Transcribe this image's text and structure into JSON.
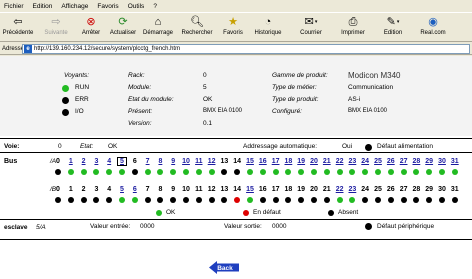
{
  "menu": {
    "items": [
      "Fichier",
      "Edition",
      "Affichage",
      "Favoris",
      "Outils",
      "?"
    ]
  },
  "toolbar": {
    "buttons": [
      {
        "label": "Précédente",
        "icon": "back-arrow-icon",
        "enabled": true
      },
      {
        "label": "Suivante",
        "icon": "forward-arrow-icon",
        "enabled": false
      },
      {
        "label": "Arrêter",
        "icon": "stop-icon",
        "enabled": true
      },
      {
        "label": "Actualiser",
        "icon": "refresh-icon",
        "enabled": true
      },
      {
        "label": "Démarrage",
        "icon": "home-icon",
        "enabled": true
      },
      {
        "label": "Rechercher",
        "icon": "search-icon",
        "enabled": true
      },
      {
        "label": "Favoris",
        "icon": "favorites-icon",
        "enabled": true
      },
      {
        "label": "Historique",
        "icon": "history-icon",
        "enabled": true
      },
      {
        "label": "Courrier",
        "icon": "mail-icon",
        "enabled": true
      },
      {
        "label": "Imprimer",
        "icon": "print-icon",
        "enabled": true
      },
      {
        "label": "Edition",
        "icon": "edit-icon",
        "enabled": true
      },
      {
        "label": "Real.com",
        "icon": "real-icon",
        "enabled": true
      }
    ]
  },
  "address": {
    "label": "Adresse",
    "url": "http://139.160.234.12/secure/system/plcctg_french.htm"
  },
  "info": {
    "voyants_label": "Voyants:",
    "leds": [
      {
        "label": "RUN",
        "color": "#22bb22"
      },
      {
        "label": "ERR",
        "color": "#000000"
      },
      {
        "label": "I/O",
        "color": "#000000"
      }
    ],
    "rack_label": "Rack:",
    "rack_value": "0",
    "module_label": "Module:",
    "module_value": "5",
    "etat_label": "Etat du module:",
    "etat_value": "OK",
    "present_label": "Présent:",
    "present_value": "BMX EIA 0100",
    "version_label": "Version:",
    "version_value": "0.1",
    "gamme_label": "Gamme de produit:",
    "gamme_value": "Modicon M340",
    "metier_label": "Type de métier:",
    "metier_value": "Communication",
    "type_label": "Type de produit:",
    "type_value": "AS-i",
    "configure_label": "Configuré:",
    "configure_value": "BMX EIA 0100"
  },
  "voie": {
    "label": "Voie:",
    "value": "0",
    "etat_label": "Etat:",
    "etat_value": "OK",
    "addr_label": "Addressage automatique:",
    "addr_value": "Oui",
    "alim_label": "Défaut alimentation",
    "alim_color": "#000000"
  },
  "bus": {
    "label": "Bus",
    "rowA_label": "/A",
    "rowB_label": "/B",
    "rowA": [
      {
        "n": "0",
        "link": false,
        "color": "#000000"
      },
      {
        "n": "1",
        "link": true,
        "color": "#22bb22"
      },
      {
        "n": "2",
        "link": true,
        "color": "#22bb22"
      },
      {
        "n": "3",
        "link": true,
        "color": "#22bb22"
      },
      {
        "n": "4",
        "link": true,
        "color": "#22bb22"
      },
      {
        "n": "5",
        "link": true,
        "color": "#22bb22",
        "selected": true
      },
      {
        "n": "6",
        "link": false,
        "color": "#000000"
      },
      {
        "n": "7",
        "link": true,
        "color": "#22bb22"
      },
      {
        "n": "8",
        "link": true,
        "color": "#22bb22"
      },
      {
        "n": "9",
        "link": true,
        "color": "#22bb22"
      },
      {
        "n": "10",
        "link": true,
        "color": "#22bb22"
      },
      {
        "n": "11",
        "link": true,
        "color": "#22bb22"
      },
      {
        "n": "12",
        "link": true,
        "color": "#22bb22"
      },
      {
        "n": "13",
        "link": false,
        "color": "#000000"
      },
      {
        "n": "14",
        "link": false,
        "color": "#000000"
      },
      {
        "n": "15",
        "link": true,
        "color": "#22bb22"
      },
      {
        "n": "16",
        "link": true,
        "color": "#22bb22"
      },
      {
        "n": "17",
        "link": true,
        "color": "#22bb22"
      },
      {
        "n": "18",
        "link": true,
        "color": "#22bb22"
      },
      {
        "n": "19",
        "link": true,
        "color": "#22bb22"
      },
      {
        "n": "20",
        "link": true,
        "color": "#22bb22"
      },
      {
        "n": "21",
        "link": true,
        "color": "#22bb22"
      },
      {
        "n": "22",
        "link": true,
        "color": "#22bb22"
      },
      {
        "n": "23",
        "link": true,
        "color": "#22bb22"
      },
      {
        "n": "24",
        "link": true,
        "color": "#22bb22"
      },
      {
        "n": "25",
        "link": true,
        "color": "#22bb22"
      },
      {
        "n": "26",
        "link": true,
        "color": "#22bb22"
      },
      {
        "n": "27",
        "link": true,
        "color": "#22bb22"
      },
      {
        "n": "28",
        "link": true,
        "color": "#22bb22"
      },
      {
        "n": "29",
        "link": true,
        "color": "#22bb22"
      },
      {
        "n": "30",
        "link": true,
        "color": "#22bb22"
      },
      {
        "n": "31",
        "link": true,
        "color": "#22bb22"
      }
    ],
    "rowB": [
      {
        "n": "0",
        "link": false,
        "color": "#000000"
      },
      {
        "n": "1",
        "link": false,
        "color": "#000000"
      },
      {
        "n": "2",
        "link": false,
        "color": "#000000"
      },
      {
        "n": "3",
        "link": false,
        "color": "#000000"
      },
      {
        "n": "4",
        "link": false,
        "color": "#000000"
      },
      {
        "n": "5",
        "link": true,
        "color": "#22bb22"
      },
      {
        "n": "6",
        "link": true,
        "color": "#22bb22"
      },
      {
        "n": "7",
        "link": false,
        "color": "#000000"
      },
      {
        "n": "8",
        "link": false,
        "color": "#000000"
      },
      {
        "n": "9",
        "link": false,
        "color": "#000000"
      },
      {
        "n": "10",
        "link": false,
        "color": "#000000"
      },
      {
        "n": "11",
        "link": false,
        "color": "#000000"
      },
      {
        "n": "12",
        "link": false,
        "color": "#000000"
      },
      {
        "n": "13",
        "link": false,
        "color": "#000000"
      },
      {
        "n": "14",
        "link": false,
        "color": "#dd0000"
      },
      {
        "n": "15",
        "link": true,
        "color": "#22bb22"
      },
      {
        "n": "16",
        "link": false,
        "color": "#000000"
      },
      {
        "n": "17",
        "link": false,
        "color": "#000000"
      },
      {
        "n": "18",
        "link": false,
        "color": "#000000"
      },
      {
        "n": "19",
        "link": false,
        "color": "#000000"
      },
      {
        "n": "20",
        "link": false,
        "color": "#000000"
      },
      {
        "n": "21",
        "link": false,
        "color": "#000000"
      },
      {
        "n": "22",
        "link": true,
        "color": "#22bb22"
      },
      {
        "n": "23",
        "link": true,
        "color": "#22bb22"
      },
      {
        "n": "24",
        "link": false,
        "color": "#000000"
      },
      {
        "n": "25",
        "link": false,
        "color": "#000000"
      },
      {
        "n": "26",
        "link": false,
        "color": "#000000"
      },
      {
        "n": "27",
        "link": false,
        "color": "#000000"
      },
      {
        "n": "28",
        "link": false,
        "color": "#000000"
      },
      {
        "n": "29",
        "link": false,
        "color": "#000000"
      },
      {
        "n": "30",
        "link": false,
        "color": "#000000"
      },
      {
        "n": "31",
        "link": false,
        "color": "#000000"
      }
    ],
    "legend": [
      {
        "label": "OK",
        "color": "#22bb22"
      },
      {
        "label": "En défaut",
        "color": "#dd0000"
      },
      {
        "label": "Absent",
        "color": "#000000"
      }
    ]
  },
  "esclave": {
    "label": "esclave",
    "id": "5/A",
    "entree_label": "Valeur entrée:",
    "entree_value": "0000",
    "sortie_label": "Valeur sortie:",
    "sortie_value": "0000",
    "defaut_label": "Défaut périphérique",
    "defaut_color": "#000000"
  },
  "back_button": {
    "label": "Back",
    "color": "#1f3fbf"
  }
}
